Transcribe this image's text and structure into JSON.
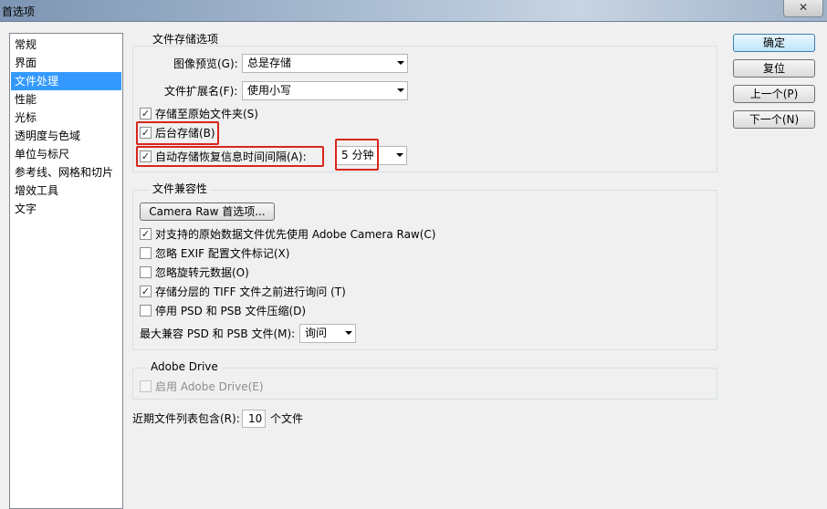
{
  "window": {
    "title": "首选项",
    "close_label": "✕"
  },
  "sidebar": {
    "items": [
      {
        "label": "常规",
        "selected": false
      },
      {
        "label": "界面",
        "selected": false
      },
      {
        "label": "文件处理",
        "selected": true
      },
      {
        "label": "性能",
        "selected": false
      },
      {
        "label": "光标",
        "selected": false
      },
      {
        "label": "透明度与色域",
        "selected": false
      },
      {
        "label": "单位与标尺",
        "selected": false
      },
      {
        "label": "参考线、网格和切片",
        "selected": false
      },
      {
        "label": "增效工具",
        "selected": false
      },
      {
        "label": "文字",
        "selected": false
      }
    ]
  },
  "file_save": {
    "group_title": "文件存储选项",
    "image_preview_label": "图像预览(G):",
    "image_preview_value": "总是存储",
    "ext_label": "文件扩展名(F):",
    "ext_value": "使用小写",
    "save_original_folder": {
      "label": "存储至原始文件夹(S)",
      "checked": true
    },
    "background_save": {
      "label": "后台存储(B)",
      "checked": true
    },
    "auto_save": {
      "label": "自动存储恢复信息时间间隔(A):",
      "checked": true
    },
    "auto_save_interval": "5 分钟"
  },
  "compat": {
    "group_title": "文件兼容性",
    "camera_raw_button": "Camera Raw 首选项...",
    "prefer_camera_raw": {
      "label": "对支持的原始数据文件优先使用 Adobe Camera Raw(C)",
      "checked": true
    },
    "ignore_exif": {
      "label": "忽略 EXIF 配置文件标记(X)",
      "checked": false
    },
    "ignore_rotation": {
      "label": "忽略旋转元数据(O)",
      "checked": false
    },
    "ask_tiff": {
      "label": "存储分层的 TIFF 文件之前进行询问 (T)",
      "checked": true
    },
    "disable_compression": {
      "label": "停用 PSD 和 PSB 文件压缩(D)",
      "checked": false
    },
    "max_compat_label": "最大兼容 PSD 和 PSB 文件(M):",
    "max_compat_value": "询问"
  },
  "adobe_drive": {
    "group_title": "Adobe Drive",
    "enable": {
      "label": "启用 Adobe Drive(E)",
      "checked": false
    }
  },
  "recent_files": {
    "label_before": "近期文件列表包含(R):",
    "value": "10",
    "label_after": "个文件"
  },
  "buttons": {
    "ok": "确定",
    "reset": "复位",
    "prev": "上一个(P)",
    "next": "下一个(N)"
  },
  "colors": {
    "selection": "#3399ff",
    "highlight_box": "#d9261c"
  }
}
